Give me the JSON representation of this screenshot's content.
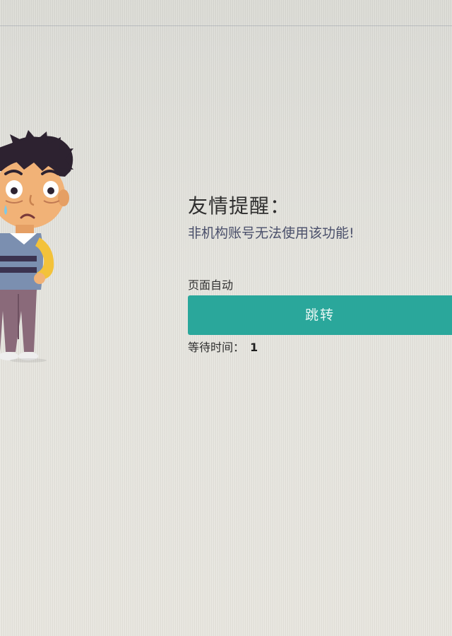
{
  "notice": {
    "title": "友情提醒：",
    "message": "非机构账号无法使用该功能!"
  },
  "redirect": {
    "auto_label": "页面自动",
    "button_label": "跳转",
    "wait_label": "等待时间：",
    "wait_seconds": "1"
  },
  "colors": {
    "button": "#2aa79b",
    "background": "#e2e1da"
  },
  "icons": {
    "mascot": "worried-boy-illustration"
  }
}
